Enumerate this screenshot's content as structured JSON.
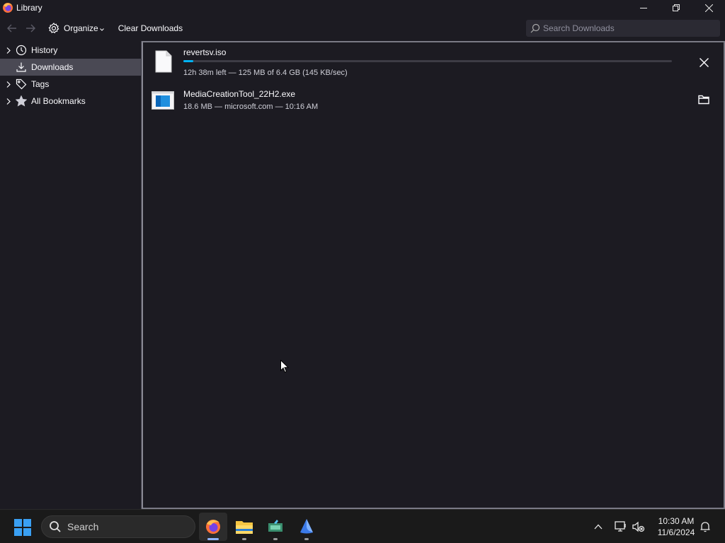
{
  "window": {
    "title": "Library"
  },
  "toolbar": {
    "organize_label": "Organize",
    "clear_label": "Clear Downloads",
    "search_placeholder": "Search Downloads"
  },
  "sidebar": {
    "items": [
      {
        "label": "History",
        "icon": "clock-icon",
        "expandable": true,
        "selected": false
      },
      {
        "label": "Downloads",
        "icon": "download-icon",
        "expandable": false,
        "selected": true
      },
      {
        "label": "Tags",
        "icon": "tag-icon",
        "expandable": true,
        "selected": false
      },
      {
        "label": "All Bookmarks",
        "icon": "star-icon",
        "expandable": true,
        "selected": false
      }
    ]
  },
  "downloads": [
    {
      "name": "revertsv.iso",
      "status": "12h 38m left — 125 MB of 6.4 GB (145 KB/sec)",
      "progress": 0.02,
      "in_progress": true,
      "icon": "file-icon",
      "action": "cancel-icon"
    },
    {
      "name": "MediaCreationTool_22H2.exe",
      "status": "18.6 MB — microsoft.com — 10:16 AM",
      "in_progress": false,
      "icon": "exe-file-icon",
      "action": "folder-icon"
    }
  ],
  "taskbar": {
    "search_label": "Search",
    "apps": [
      "firefox-icon",
      "file-explorer-icon",
      "app-icon",
      "edge-like-icon"
    ],
    "time": "10:30 AM",
    "date": "11/6/2024"
  },
  "colors": {
    "accent": "#00b3f4",
    "background": "#1c1b22",
    "selected": "#4a4954"
  }
}
